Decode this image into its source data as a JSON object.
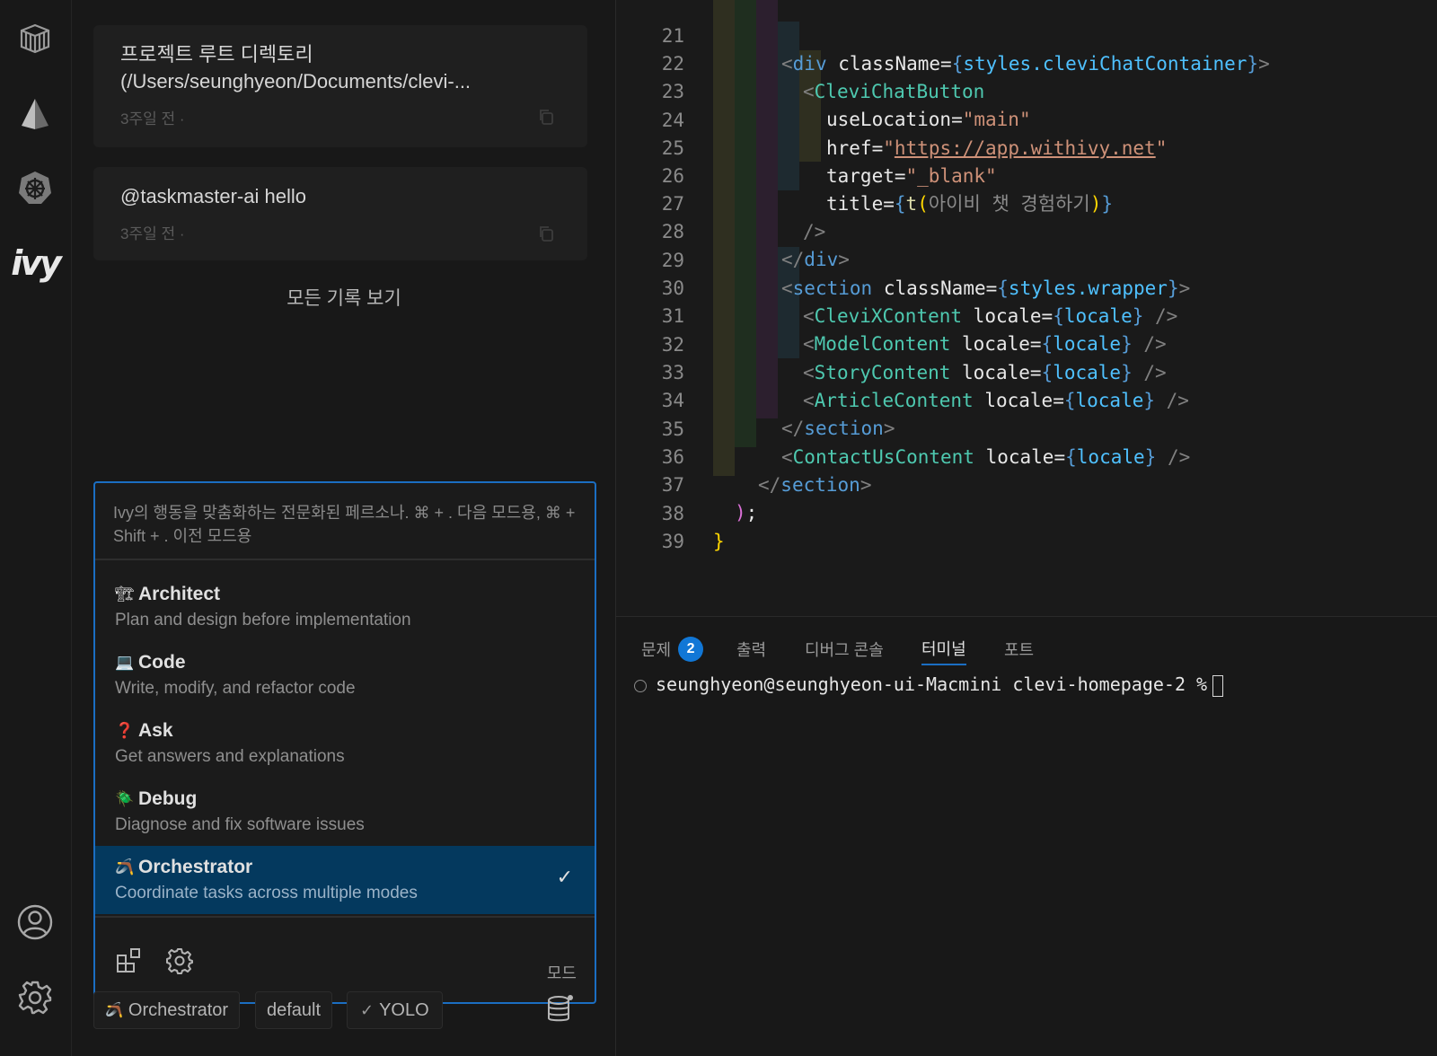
{
  "activity_bar": {
    "icons": [
      "package-icon",
      "prism-icon",
      "helm-icon",
      "ivy-logo"
    ],
    "ivy_logo_text": "ivy",
    "bottom_icons": [
      "account-icon",
      "settings-gear-icon"
    ]
  },
  "history": {
    "items": [
      {
        "title_line1": "프로젝트 루트 디렉토리",
        "title_line2": "(/Users/seunghyeon/Documents/clevi-...",
        "meta": "3주일 전 ·"
      },
      {
        "title_line1": "@taskmaster-ai hello",
        "meta": "3주일 전 ·"
      }
    ],
    "view_all": "모든 기록 보기"
  },
  "mode_popup": {
    "description": "Ivy의 행동을 맞춤화하는 전문화된 페르소나. ⌘ + . 다음 모드용, ⌘ + Shift + . 이전 모드용",
    "modes": [
      {
        "emoji": "🏗",
        "name": "Architect",
        "desc": "Plan and design before implementation"
      },
      {
        "emoji": "💻",
        "name": "Code",
        "desc": "Write, modify, and refactor code"
      },
      {
        "emoji": "❓",
        "name": "Ask",
        "desc": "Get answers and explanations"
      },
      {
        "emoji": "🪲",
        "name": "Debug",
        "desc": "Diagnose and fix software issues"
      },
      {
        "emoji": "🪃",
        "name": "Orchestrator",
        "desc": "Coordinate tasks across multiple modes"
      }
    ],
    "selected_index": 4,
    "check": "✓",
    "footer_label": "모드"
  },
  "bottom_bar": {
    "mode_pill": "Orchestrator",
    "mode_pill_emoji": "🪃",
    "profile_pill": "default",
    "yolo_pill": "YOLO",
    "yolo_check": "✓"
  },
  "editor": {
    "lines": [
      {
        "num": "21"
      },
      {
        "num": "22"
      },
      {
        "num": "23"
      },
      {
        "num": "24"
      },
      {
        "num": "25"
      },
      {
        "num": "26"
      },
      {
        "num": "27"
      },
      {
        "num": "28"
      },
      {
        "num": "29"
      },
      {
        "num": "30"
      },
      {
        "num": "31"
      },
      {
        "num": "32"
      },
      {
        "num": "33"
      },
      {
        "num": "34"
      },
      {
        "num": "35"
      },
      {
        "num": "36"
      },
      {
        "num": "37"
      },
      {
        "num": "38"
      },
      {
        "num": "39"
      }
    ],
    "code": {
      "l21": [
        "<",
        "div",
        " className",
        "=",
        "{",
        "styles.cleviChatContainer",
        "}",
        ">"
      ],
      "l22": [
        "<",
        "CleviChatButton"
      ],
      "l23": [
        "useLocation",
        "=",
        "\"main\""
      ],
      "l24": [
        "href",
        "=",
        "\"",
        "https://app.withivy.net",
        "\""
      ],
      "l25": [
        "target",
        "=",
        "\"_blank\""
      ],
      "l26": [
        "title",
        "=",
        "{",
        "t",
        "(",
        "아이비 챗 경험하기",
        ")",
        "}"
      ],
      "l27": [
        "/>"
      ],
      "l28": [
        "</",
        "div",
        ">"
      ],
      "l29": [
        "<",
        "section",
        " className",
        "=",
        "{",
        "styles.wrapper",
        "}",
        ">"
      ],
      "l30": [
        "<",
        "CleviXContent",
        " locale",
        "=",
        "{",
        "locale",
        "}",
        " />"
      ],
      "l31": [
        "<",
        "ModelContent",
        " locale",
        "=",
        "{",
        "locale",
        "}",
        " />"
      ],
      "l32": [
        "<",
        "StoryContent",
        " locale",
        "=",
        "{",
        "locale",
        "}",
        " />"
      ],
      "l33": [
        "<",
        "ArticleContent",
        " locale",
        "=",
        "{",
        "locale",
        "}",
        " />"
      ],
      "l34": [
        "</",
        "section",
        ">"
      ],
      "l35": [
        "<",
        "ContactUsContent",
        " locale",
        "=",
        "{",
        "locale",
        "}",
        " />"
      ],
      "l36": [
        "</",
        "section",
        ">"
      ],
      "l37": [
        ")",
        ";"
      ],
      "l38": [
        "}"
      ]
    }
  },
  "panel": {
    "tabs": [
      {
        "label": "문제",
        "badge": "2"
      },
      {
        "label": "출력"
      },
      {
        "label": "디버그 콘솔"
      },
      {
        "label": "터미널",
        "active": true
      },
      {
        "label": "포트"
      }
    ],
    "terminal_prompt": "seunghyeon@seunghyeon-ui-Macmini clevi-homepage-2 %"
  },
  "colors": {
    "accent": "#1b6ec2",
    "selection": "#04395e",
    "badge": "#1177d6"
  }
}
